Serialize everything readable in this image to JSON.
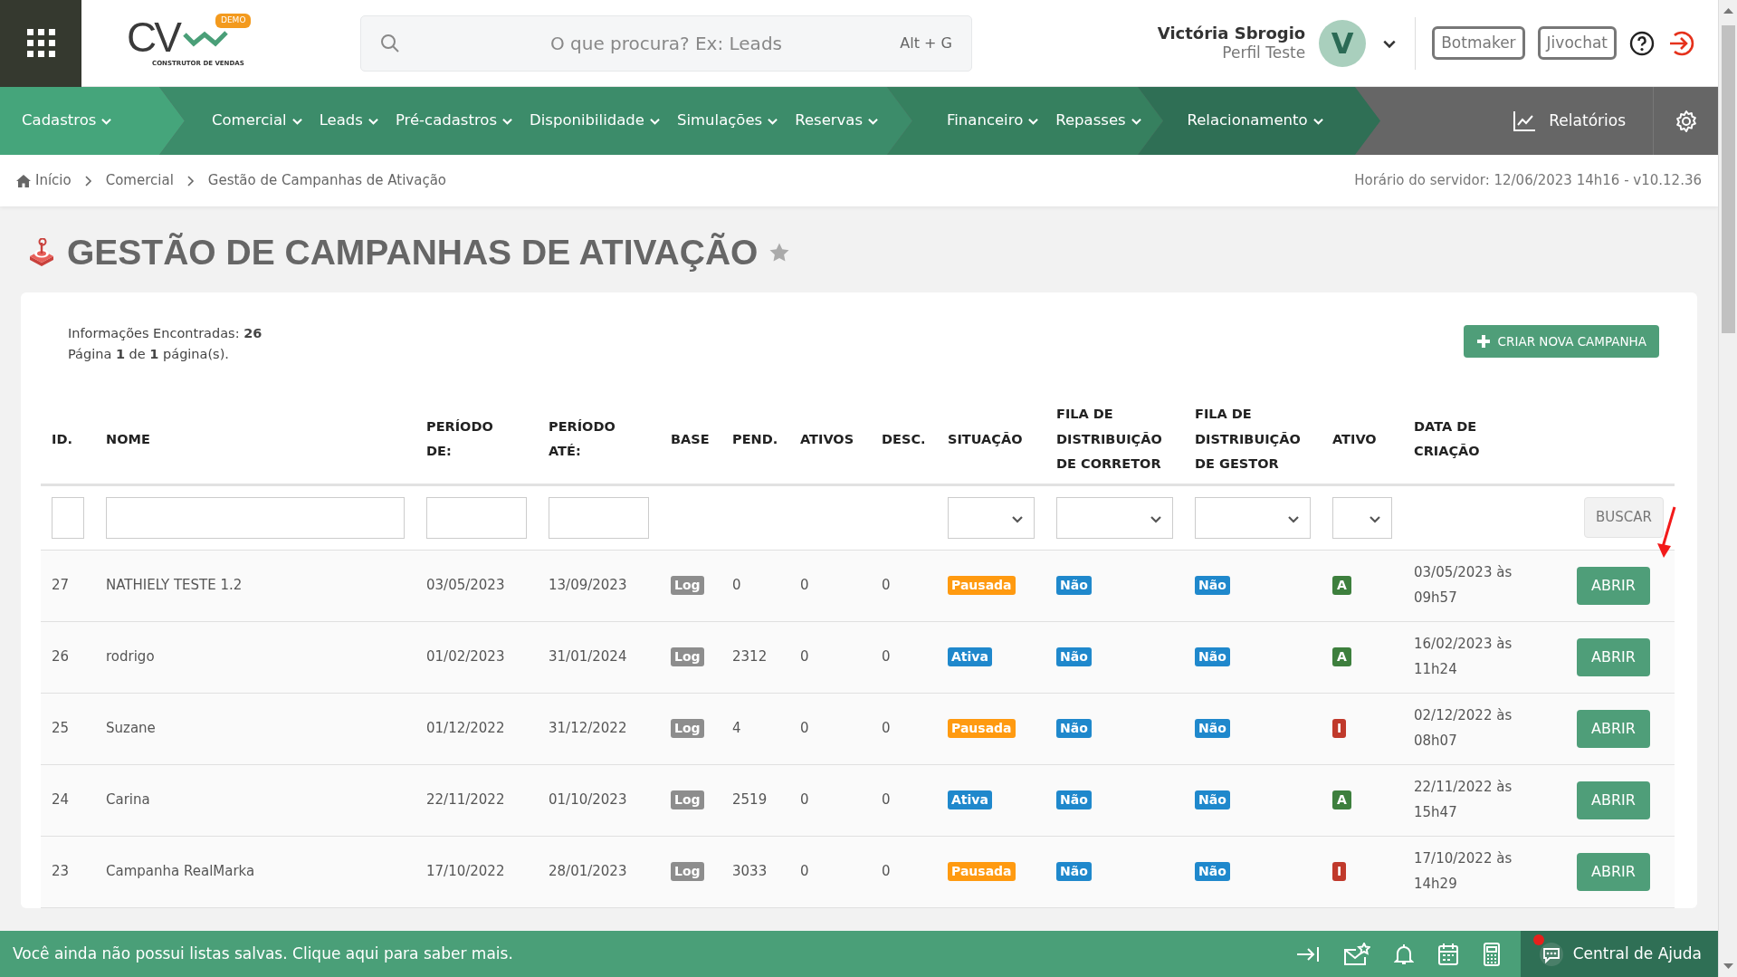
{
  "header": {
    "logo": {
      "letters": "CV",
      "badge": "DEMO",
      "tagline": "CONSTRUTOR DE VENDAS"
    },
    "search": {
      "placeholder": "O que procura? Ex: Leads",
      "shortcut": "Alt + G"
    },
    "user": {
      "name": "Victória Sbrogio",
      "profile": "Perfil Teste",
      "initial": "V"
    },
    "buttons": [
      "Botmaker",
      "Jivochat"
    ]
  },
  "nav": {
    "groups": [
      {
        "items": [
          "Cadastros"
        ]
      },
      {
        "items": [
          "Comercial",
          "Leads",
          "Pré-cadastros",
          "Disponibilidade",
          "Simulações",
          "Reservas"
        ]
      },
      {
        "items": [
          "Financeiro",
          "Repasses"
        ]
      },
      {
        "items": [
          "Relacionamento"
        ]
      }
    ],
    "reports": "Relatórios"
  },
  "breadcrumb": {
    "items": [
      "Início",
      "Comercial",
      "Gestão de Campanhas de Ativação"
    ],
    "server_info": "Horário do servidor: 12/06/2023 14h16 - v10.12.36"
  },
  "page_title": "GESTÃO DE CAMPANHAS DE ATIVAÇÃO",
  "summary": [
    "Informações Encontradas: **26**",
    "Página **1** de **1** página(s)."
  ],
  "create_button": "CRIAR NOVA CAMPANHA",
  "table": {
    "columns": [
      {
        "label": "ID.",
        "kind": "text"
      },
      {
        "label": "NOME",
        "kind": "text"
      },
      {
        "label": "PERÍODO DE:",
        "kind": "text"
      },
      {
        "label": "PERÍODO ATÉ:",
        "kind": "text"
      },
      {
        "label": "BASE",
        "kind": "plain"
      },
      {
        "label": "PEND.",
        "kind": "plain"
      },
      {
        "label": "ATIVOS",
        "kind": "plain"
      },
      {
        "label": "DESC.",
        "kind": "plain"
      },
      {
        "label": "SITUAÇÃO",
        "kind": "select"
      },
      {
        "label": "FILA DE DISTRIBUIÇÃO DE CORRETOR",
        "kind": "select"
      },
      {
        "label": "FILA DE DISTRIBUIÇÃO DE GESTOR",
        "kind": "select"
      },
      {
        "label": "ATIVO",
        "kind": "select"
      },
      {
        "label": "DATA DE CRIAÇÃO",
        "kind": "plain"
      }
    ],
    "search_button": "BUSCAR",
    "rows": [
      {
        "id": "27",
        "name": "NATHIELY TESTE 1.2",
        "from": "03/05/2023",
        "to": "13/09/2023",
        "base": "Log",
        "pending": "0",
        "active_count": "0",
        "discarded": "0",
        "status": {
          "text": "Pausada",
          "kind": "paused"
        },
        "broker_queue": "Não",
        "manager_queue": "Não",
        "active": {
          "text": "A",
          "kind": "active"
        },
        "created": "03/05/2023 às 09h57",
        "action": "ABRIR"
      },
      {
        "id": "26",
        "name": "rodrigo",
        "from": "01/02/2023",
        "to": "31/01/2024",
        "base": "Log",
        "pending": "2312",
        "active_count": "0",
        "discarded": "0",
        "status": {
          "text": "Ativa",
          "kind": "active"
        },
        "broker_queue": "Não",
        "manager_queue": "Não",
        "active": {
          "text": "A",
          "kind": "active"
        },
        "created": "16/02/2023 às 11h24",
        "action": "ABRIR"
      },
      {
        "id": "25",
        "name": "Suzane",
        "from": "01/12/2022",
        "to": "31/12/2022",
        "base": "Log",
        "pending": "4",
        "active_count": "0",
        "discarded": "0",
        "status": {
          "text": "Pausada",
          "kind": "paused"
        },
        "broker_queue": "Não",
        "manager_queue": "Não",
        "active": {
          "text": "I",
          "kind": "inactive"
        },
        "created": "02/12/2022 às 08h07",
        "action": "ABRIR"
      },
      {
        "id": "24",
        "name": "Carina",
        "from": "22/11/2022",
        "to": "01/10/2023",
        "base": "Log",
        "pending": "2519",
        "active_count": "0",
        "discarded": "0",
        "status": {
          "text": "Ativa",
          "kind": "active"
        },
        "broker_queue": "Não",
        "manager_queue": "Não",
        "active": {
          "text": "A",
          "kind": "active"
        },
        "created": "22/11/2022 às 15h47",
        "action": "ABRIR"
      },
      {
        "id": "23",
        "name": "Campanha RealMarka",
        "from": "17/10/2022",
        "to": "28/01/2023",
        "base": "Log",
        "pending": "3033",
        "active_count": "0",
        "discarded": "0",
        "status": {
          "text": "Pausada",
          "kind": "paused"
        },
        "broker_queue": "Não",
        "manager_queue": "Não",
        "active": {
          "text": "I",
          "kind": "inactive"
        },
        "created": "17/10/2022 às 14h29",
        "action": "ABRIR"
      }
    ]
  },
  "bottom_bar": {
    "message": "Você ainda não possui listas salvas. Clique aqui para saber mais.",
    "help": "Central de Ajuda"
  }
}
